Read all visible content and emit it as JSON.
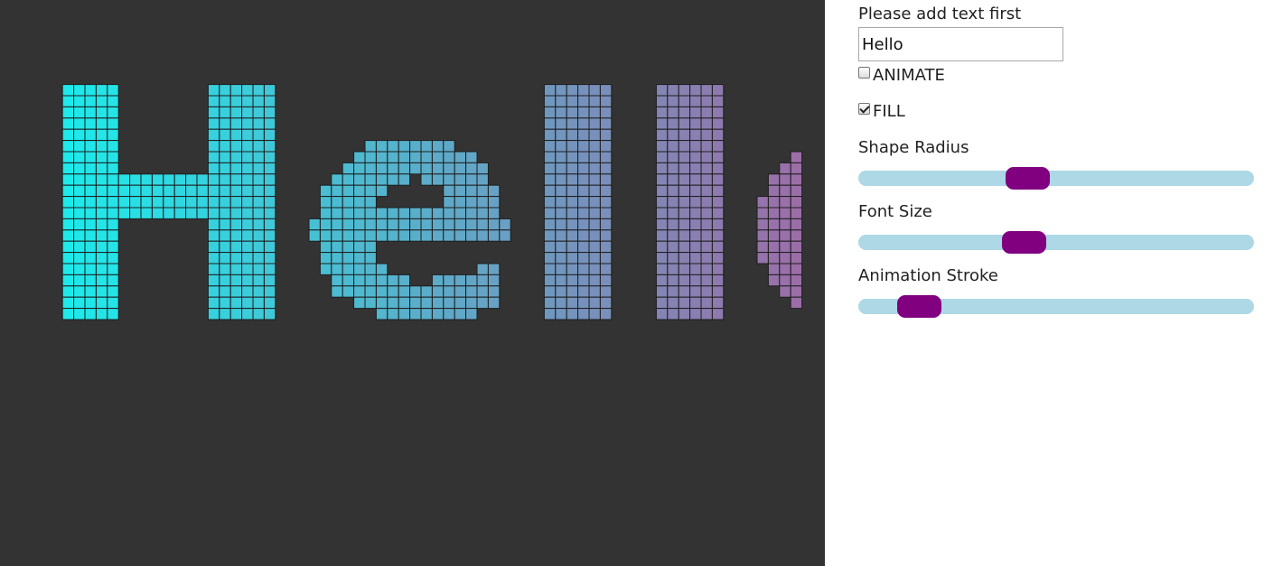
{
  "canvas": {
    "text": "Hello",
    "background_color": "#333333",
    "gradient_start_color": "#17f0ee",
    "gradient_end_color": "#9b6ea8",
    "grid_line_color": "#1e1e1e"
  },
  "controls": {
    "text_prompt": "Please add text first",
    "text_value": "Hello",
    "animate_label": "ANIMATE",
    "animate_checked": false,
    "fill_label": "FILL",
    "fill_checked": true,
    "shape_radius_label": "Shape Radius",
    "shape_radius_fraction": 0.42,
    "font_size_label": "Font Size",
    "font_size_fraction": 0.41,
    "animation_stroke_label": "Animation Stroke",
    "animation_stroke_fraction": 0.11,
    "slider_track_color": "#add8e6",
    "slider_thumb_color": "#800080"
  }
}
